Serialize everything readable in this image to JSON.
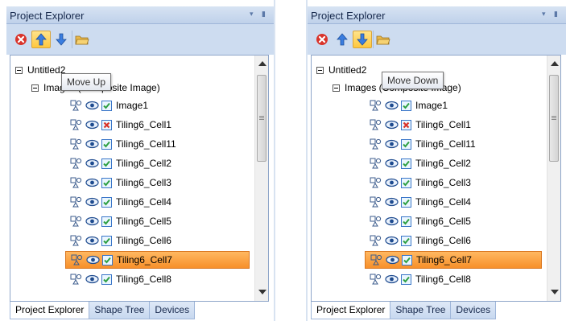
{
  "panels": [
    {
      "title": "Project Explorer",
      "toolbar": [
        {
          "icon": "delete-icon"
        },
        {
          "icon": "move-up-arrow-icon",
          "active": true
        },
        {
          "icon": "move-down-arrow-icon"
        },
        {
          "icon": "folder-icon"
        }
      ],
      "tooltip": "Move Up",
      "root": "Untitled2",
      "group": "Images (Composite Image)",
      "items": [
        {
          "label": "Image1",
          "checked": true,
          "selected": false
        },
        {
          "label": "Tiling6_Cell1",
          "checked": false,
          "selected": false
        },
        {
          "label": "Tiling6_Cell11",
          "checked": true,
          "selected": false
        },
        {
          "label": "Tiling6_Cell2",
          "checked": true,
          "selected": false
        },
        {
          "label": "Tiling6_Cell3",
          "checked": true,
          "selected": false
        },
        {
          "label": "Tiling6_Cell4",
          "checked": true,
          "selected": false
        },
        {
          "label": "Tiling6_Cell5",
          "checked": true,
          "selected": false
        },
        {
          "label": "Tiling6_Cell6",
          "checked": true,
          "selected": false
        },
        {
          "label": "Tiling6_Cell7",
          "checked": true,
          "selected": true
        },
        {
          "label": "Tiling6_Cell8",
          "checked": true,
          "selected": false
        }
      ],
      "tabs": [
        {
          "label": "Project Explorer",
          "active": true
        },
        {
          "label": "Shape Tree",
          "active": false
        },
        {
          "label": "Devices",
          "active": false
        }
      ]
    },
    {
      "title": "Project Explorer",
      "toolbar": [
        {
          "icon": "delete-icon"
        },
        {
          "icon": "move-up-arrow-icon"
        },
        {
          "icon": "move-down-arrow-icon",
          "active": true
        },
        {
          "icon": "folder-icon"
        }
      ],
      "tooltip": "Move Down",
      "root": "Untitled2",
      "group": "Images (Composite Image)",
      "items": [
        {
          "label": "Image1",
          "checked": true,
          "selected": false
        },
        {
          "label": "Tiling6_Cell1",
          "checked": false,
          "selected": false
        },
        {
          "label": "Tiling6_Cell11",
          "checked": true,
          "selected": false
        },
        {
          "label": "Tiling6_Cell2",
          "checked": true,
          "selected": false
        },
        {
          "label": "Tiling6_Cell3",
          "checked": true,
          "selected": false
        },
        {
          "label": "Tiling6_Cell4",
          "checked": true,
          "selected": false
        },
        {
          "label": "Tiling6_Cell5",
          "checked": true,
          "selected": false
        },
        {
          "label": "Tiling6_Cell6",
          "checked": true,
          "selected": false
        },
        {
          "label": "Tiling6_Cell7",
          "checked": true,
          "selected": true
        },
        {
          "label": "Tiling6_Cell8",
          "checked": true,
          "selected": false
        }
      ],
      "tabs": [
        {
          "label": "Project Explorer",
          "active": true
        },
        {
          "label": "Shape Tree",
          "active": false
        },
        {
          "label": "Devices",
          "active": false
        }
      ]
    }
  ]
}
